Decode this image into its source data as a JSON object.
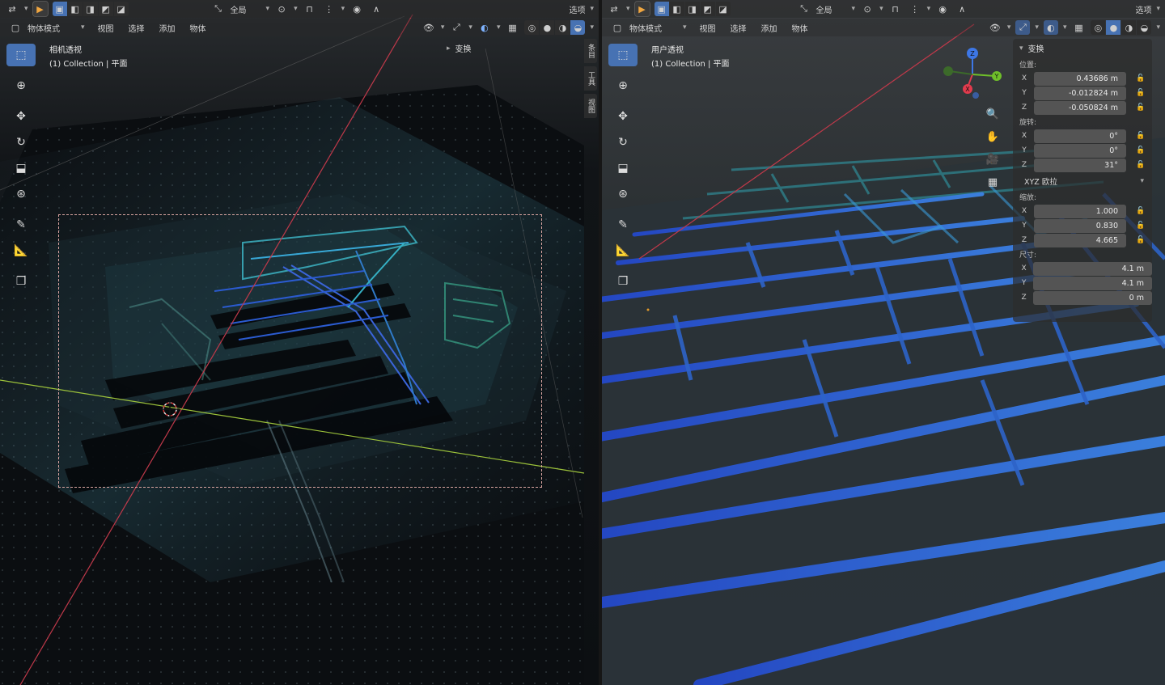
{
  "left": {
    "header": {
      "options_label": "选项",
      "global_label": "全局",
      "mode_label": "物体模式",
      "menus": [
        "视图",
        "选择",
        "添加",
        "物体"
      ],
      "panel_toggle_label": "变换"
    },
    "view_title": "相机透视",
    "view_subtitle": "(1) Collection | 平面",
    "side_tabs": [
      "条目",
      "工具",
      "视图"
    ]
  },
  "right": {
    "header": {
      "options_label": "选项",
      "global_label": "全局",
      "mode_label": "物体模式",
      "menus": [
        "视图",
        "选择",
        "添加",
        "物体"
      ]
    },
    "view_title": "用户透视",
    "view_subtitle": "(1) Collection | 平面",
    "transform": {
      "title": "变换",
      "location_label": "位置:",
      "location": {
        "x": "0.43686 m",
        "y": "-0.012824 m",
        "z": "-0.050824 m"
      },
      "rotation_label": "旋转:",
      "rotation": {
        "x": "0°",
        "y": "0°",
        "z": "31°"
      },
      "rotation_mode": "XYZ 欧拉",
      "scale_label": "缩放:",
      "scale": {
        "x": "1.000",
        "y": "0.830",
        "z": "4.665"
      },
      "dimensions_label": "尺寸:",
      "dimensions": {
        "x": "4.1 m",
        "y": "4.1 m",
        "z": "0 m"
      },
      "axis_labels": {
        "x": "X",
        "y": "Y",
        "z": "Z"
      }
    },
    "gizmo": {
      "x": "X",
      "y": "Y",
      "z": "Z"
    }
  },
  "icons": {
    "tools": [
      "select-box-icon",
      "cursor-icon",
      "move-icon",
      "rotate-icon",
      "scale-icon",
      "transform-icon",
      "annotate-icon",
      "measure-icon",
      "add-cube-icon"
    ],
    "nav": [
      "zoom-icon",
      "pan-icon",
      "camera-icon",
      "grid-icon"
    ]
  },
  "colors": {
    "accent": "#4772b3",
    "pipe_blue": "#2f5fd6",
    "pipe_cyan": "#2fb0c8",
    "axis_red": "#c0394a",
    "axis_green": "#9cc23a",
    "gizmo_blue": "#3d77e6",
    "gizmo_red": "#e23b4d",
    "gizmo_green": "#6fbf2a"
  }
}
